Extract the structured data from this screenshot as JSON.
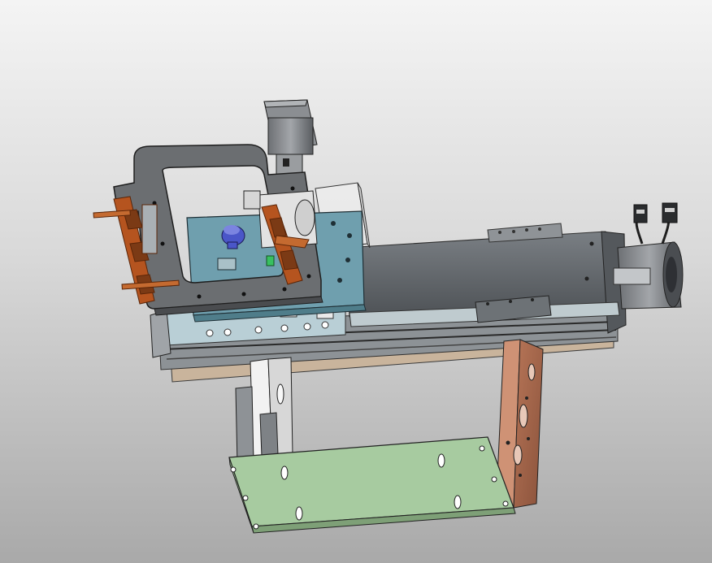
{
  "scene": {
    "background_top": "#f4f4f4",
    "background_bottom": "#a9a9a9",
    "colors": {
      "rail_body": "#5e6266",
      "rail_light": "#b7c4c8",
      "carriage_plate": "#6a6d70",
      "blue_plate": "#6f9fae",
      "green_plate": "#a7cba0",
      "copper_plate": "#a0644a",
      "motor_dark": "#3a3d40",
      "motor_metal": "#9a9da0",
      "copper_parts": "#b5541f",
      "knob_blue": "#4a56c8",
      "led_green": "#38c060"
    }
  }
}
